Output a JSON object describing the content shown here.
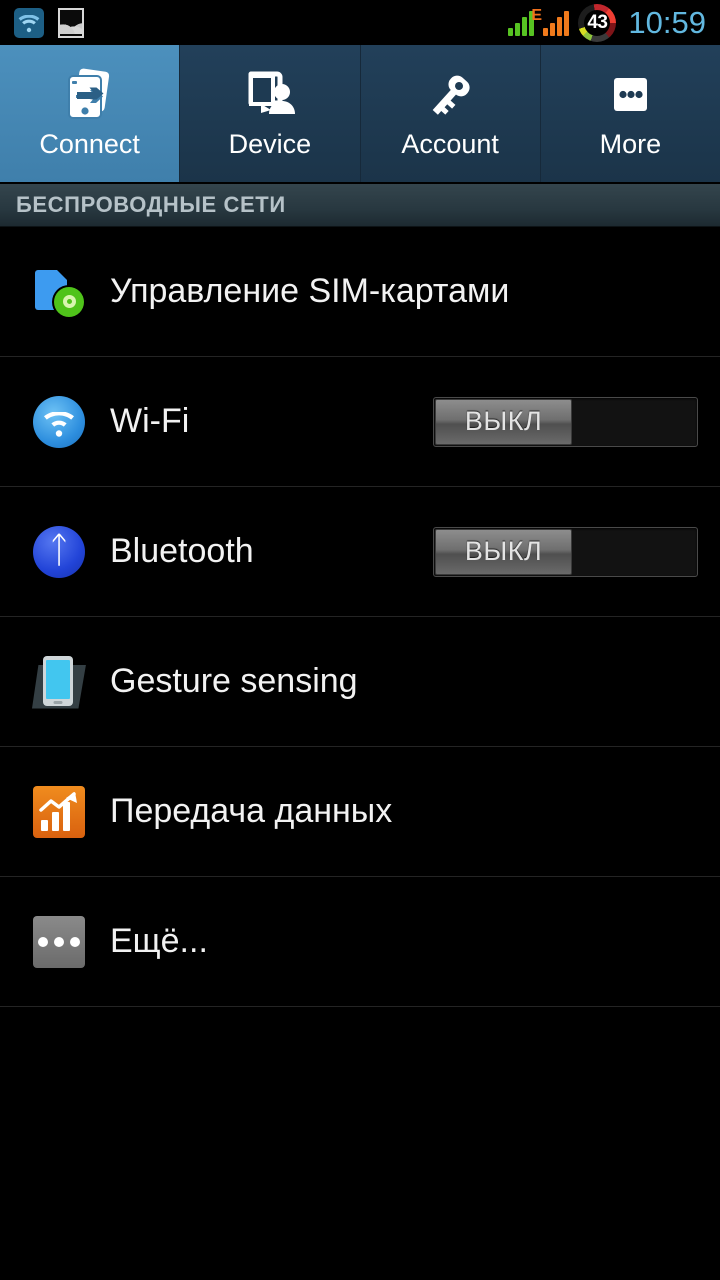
{
  "statusbar": {
    "left_icons": [
      {
        "name": "wifi-status-icon",
        "label": "wifi"
      },
      {
        "name": "screenshot-icon",
        "label": "screenshot"
      }
    ],
    "signal_green": {
      "name": "signal-sim1-icon",
      "bars": 4
    },
    "signal_orange": {
      "name": "signal-sim2-icon",
      "bars": 4,
      "network_type": "E"
    },
    "battery": {
      "name": "battery-icon",
      "percent": "43"
    },
    "clock": "10:59",
    "colors": {
      "clock": "#62b8e0",
      "signal_green": "#57c322",
      "signal_orange": "#f07a1c",
      "network_letter": "#f0701c"
    }
  },
  "tabs": [
    {
      "label": "Connect",
      "icon": "connect-transfer-icon",
      "active": true
    },
    {
      "label": "Device",
      "icon": "device-user-icon",
      "active": false
    },
    {
      "label": "Account",
      "icon": "key-icon",
      "active": false
    },
    {
      "label": "More",
      "icon": "three-dots-square-icon",
      "active": false
    }
  ],
  "section": {
    "title": "БЕСПРОВОДНЫЕ СЕТИ"
  },
  "rows": [
    {
      "label": "Управление SIM-картами",
      "icon": "sim-management-icon",
      "toggle": null
    },
    {
      "label": "Wi-Fi",
      "icon": "wifi-icon",
      "toggle": "ВЫКЛ"
    },
    {
      "label": "Bluetooth",
      "icon": "bluetooth-icon",
      "toggle": "ВЫКЛ"
    },
    {
      "label": "Gesture sensing",
      "icon": "gesture-sensing-icon",
      "toggle": null
    },
    {
      "label": "Передача данных",
      "icon": "data-usage-icon",
      "toggle": null
    },
    {
      "label": "Ещё...",
      "icon": "more-dots-icon",
      "toggle": null
    }
  ],
  "colors": {
    "tab_active": "#4586b5",
    "tab_inactive": "#1e3a52",
    "section_header_bg": "#2b3c44",
    "section_header_text": "#b6c2c8",
    "row_text": "#f2f2f2",
    "divider": "#242424",
    "background": "#000000"
  }
}
